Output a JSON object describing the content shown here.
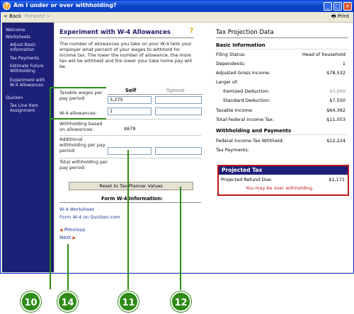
{
  "window": {
    "title": "Am I under or over withholding?",
    "back_label": "< Back",
    "forward_label": "Forward >",
    "print_label": "Print"
  },
  "sidebar": {
    "items": [
      {
        "label": "Welcome"
      },
      {
        "label": "Worksheets"
      },
      {
        "label": "Adjust Basic Information"
      },
      {
        "label": "Tax Payments"
      },
      {
        "label": "Estimate Future Withholding"
      },
      {
        "label": "Experiment with W-4 Allowances"
      },
      {
        "label": "Quicken"
      },
      {
        "label": "Tax Line Item Assignment"
      }
    ]
  },
  "experiment": {
    "title": "Experiment with W-4 Allowances",
    "intro": "The number of allowances you take on your W-4 tells your employer what percent of your wages to withhold for income tax. The lower the number of allowance, the more tax will be withheld and the lower your take home pay will be.",
    "col_self": "Self",
    "col_spouse": "Spouse",
    "taxable_wages_label": "Taxable wages per pay period:",
    "taxable_wages_self": "3,275",
    "taxable_wages_spouse": "",
    "allowances_label": "W-4 allowances:",
    "allowances_self": "1",
    "allowances_spouse": "",
    "withholding_based_label": "Withholding based on allowances:",
    "withholding_based_self": "$679",
    "additional_label": "Additional withholding per pay period:",
    "additional_self": "",
    "additional_spouse": "",
    "total_label": "Total withholding per pay period:",
    "reset_label": "Reset to Tax Planner Values",
    "w4_info_heading": "Form W-4 Information:",
    "w4_worksheet_link": "W-4 Worksheet",
    "w4_quicken_link": "Form W-4 on Quicken.com",
    "previous_label": "Previous",
    "next_label": "Next"
  },
  "projection": {
    "title": "Tax Projection Data",
    "basic_heading": "Basic Information",
    "rows": [
      {
        "label": "Filing Status:",
        "value": "Head of household"
      },
      {
        "label": "Dependents:",
        "value": "1"
      },
      {
        "label": "Adjusted Gross Income:",
        "value": "$78,532"
      },
      {
        "label": "Larger of:",
        "value": ""
      },
      {
        "label": "Itemized Deduction:",
        "value": "$4,888"
      },
      {
        "label": "Standard Deduction:",
        "value": "$7,550"
      },
      {
        "label": "Taxable Income:",
        "value": "$64,382"
      },
      {
        "label": "Total Federal Income Tax:",
        "value": "$11,053"
      }
    ],
    "withholding_heading": "Withholding and Payments",
    "withholding_rows": [
      {
        "label": "Federal Income Tax Withheld:",
        "value": "$12,224"
      },
      {
        "label": "Tax Payments:",
        "value": ""
      }
    ],
    "projected_heading": "Projected Tax",
    "refund_label": "Projected Refund Due:",
    "refund_value": "$1,171",
    "warning": "You may be over withholding."
  },
  "callouts": [
    "10",
    "14",
    "11",
    "12"
  ],
  "colors": {
    "sidebar_bg": "#1c2077",
    "callout": "#2e8b16",
    "warning": "#c01818"
  }
}
